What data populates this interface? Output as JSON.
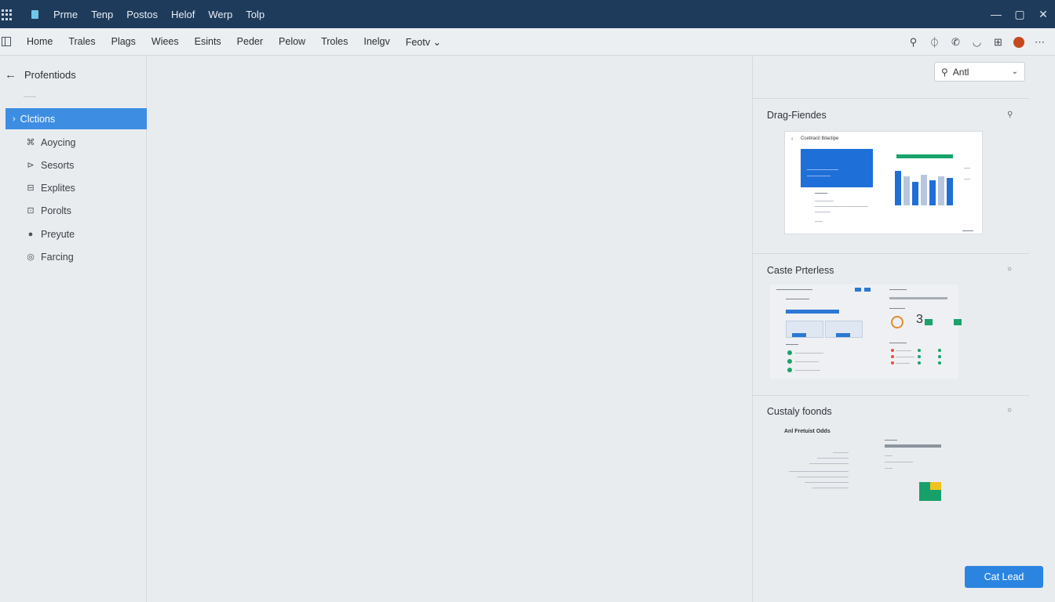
{
  "titlebar": {
    "menus": [
      "Prme",
      "Tenp",
      "Postos",
      "Helof",
      "Werp",
      "Tolp"
    ],
    "icons": {
      "grid": "app-grid-icon",
      "app": "app-icon"
    },
    "window_controls": {
      "minimize": "—",
      "maximize": "▢",
      "close": "✕"
    }
  },
  "toolbar": {
    "nav": [
      "Home",
      "Trales",
      "Plags",
      "Wiees",
      "Esints",
      "Peder",
      "Pelow",
      "Troles",
      "Inelgv",
      "Feotv ⌄"
    ],
    "tools": [
      "⚲",
      "⏀",
      "✆",
      "◡",
      "⊞",
      "⋯"
    ]
  },
  "sidebar": {
    "back_icon": "←",
    "title": "Profentiods",
    "items": [
      {
        "label": "Clctions",
        "icon": "›",
        "active": true
      },
      {
        "label": "Aoycing",
        "icon": "⌘",
        "active": false
      },
      {
        "label": "Sesorts",
        "icon": "⊳",
        "active": false
      },
      {
        "label": "Explites",
        "icon": "⊟",
        "active": false
      },
      {
        "label": "Porolts",
        "icon": "⊡",
        "active": false
      },
      {
        "label": "Preyute",
        "icon": "●",
        "active": false
      },
      {
        "label": "Farcing",
        "icon": "◎",
        "active": false
      }
    ]
  },
  "right_panel": {
    "select": {
      "value": "Antl",
      "icon": "⚲",
      "chevron": "⌄"
    },
    "sections": [
      {
        "title": "Drag-Fiendes",
        "icon": "⚲"
      },
      {
        "title": "Caste Prterless",
        "icon": "○"
      },
      {
        "title": "Custaly foonds",
        "icon": "○"
      }
    ],
    "thumb1": {
      "heading": "Ccetiracil Iblaclipe",
      "bar_levels": [
        0.95,
        0.8,
        0.65,
        0.85,
        0.7,
        0.8,
        0.75
      ]
    },
    "thumb2": {
      "numeral": "3"
    },
    "thumb3": {
      "heading": "Anl Fretuist Odds"
    }
  },
  "cta": {
    "label": "Cat Lead"
  },
  "colors": {
    "titlebar": "#1f3b5c",
    "accent": "#3d8ee3",
    "cta": "#2b85e0",
    "green": "#1aa36b",
    "orange": "#e88a2e"
  }
}
